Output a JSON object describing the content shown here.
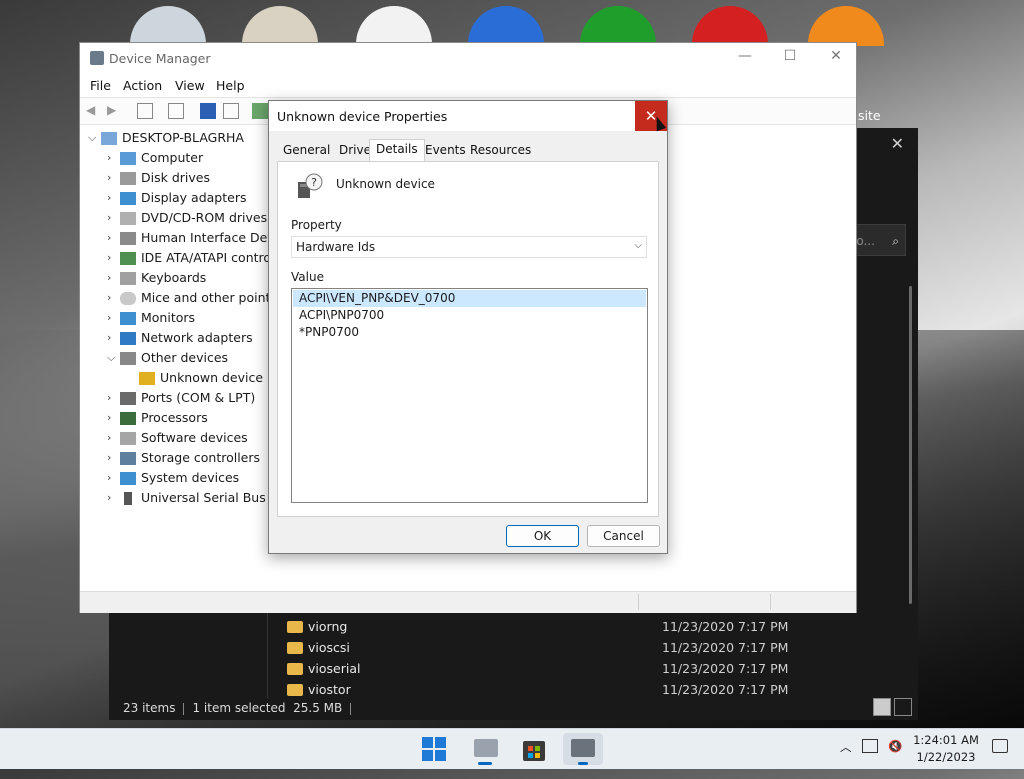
{
  "desktop": {
    "partial_label": "site"
  },
  "explorer": {
    "search_placeholder": "io...",
    "files": [
      {
        "name": "viorng",
        "date": "11/23/2020 7:17 PM"
      },
      {
        "name": "vioscsi",
        "date": "11/23/2020 7:17 PM"
      },
      {
        "name": "vioserial",
        "date": "11/23/2020 7:17 PM"
      },
      {
        "name": "viostor",
        "date": "11/23/2020 7:17 PM"
      }
    ],
    "status": {
      "items": "23 items",
      "selected": "1 item selected",
      "size": "25.5 MB"
    }
  },
  "device_manager": {
    "title": "Device Manager",
    "menu": [
      "File",
      "Action",
      "View",
      "Help"
    ],
    "tree": {
      "root": "DESKTOP-BLAGRHA",
      "nodes": [
        "Computer",
        "Disk drives",
        "Display adapters",
        "DVD/CD-ROM drives",
        "Human Interface Devic",
        "IDE ATA/ATAPI controll",
        "Keyboards",
        "Mice and other pointi",
        "Monitors",
        "Network adapters",
        "Other devices",
        "Unknown device",
        "Ports (COM & LPT)",
        "Processors",
        "Software devices",
        "Storage controllers",
        "System devices",
        "Universal Serial Bus co"
      ]
    }
  },
  "dialog": {
    "title": "Unknown device Properties",
    "close_glyph": "✕",
    "tabs": [
      "General",
      "Driver",
      "Details",
      "Events",
      "Resources"
    ],
    "active_tab": "Details",
    "device_name": "Unknown device",
    "property_label": "Property",
    "property_value": "Hardware Ids",
    "value_label": "Value",
    "values": [
      "ACPI\\VEN_PNP&DEV_0700",
      "ACPI\\PNP0700",
      "*PNP0700"
    ],
    "ok": "OK",
    "cancel": "Cancel"
  },
  "taskbar": {
    "time": "1:24:01 AM",
    "date": "1/22/2023"
  },
  "colors": {
    "accent": "#0067c0",
    "close_red": "#c42b1c",
    "selection": "#cce8ff"
  }
}
